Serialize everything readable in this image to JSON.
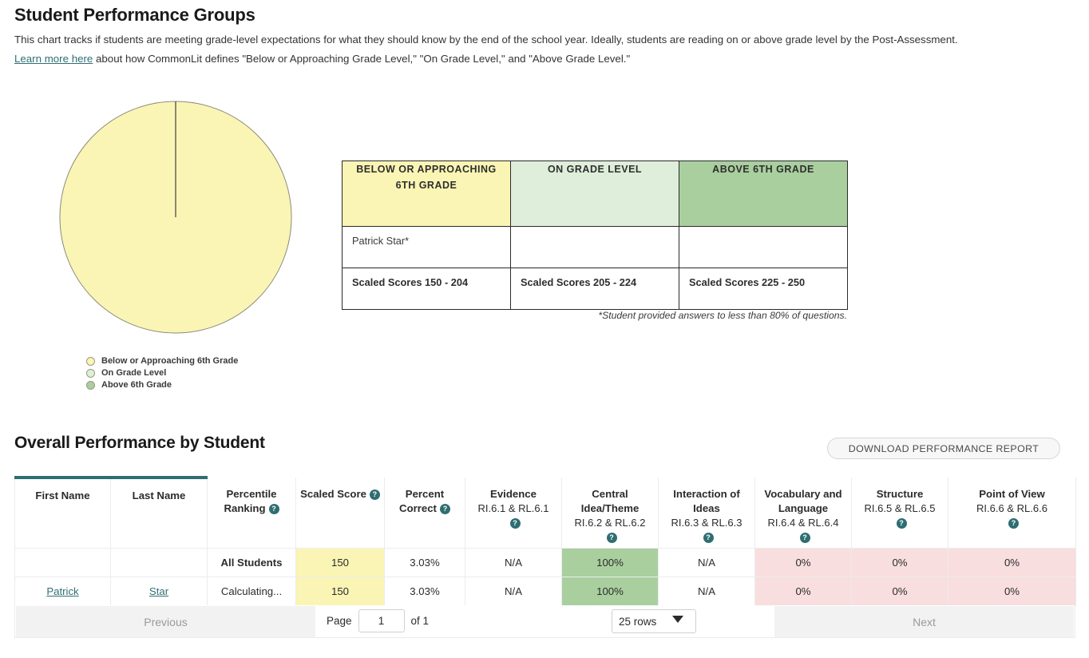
{
  "groups": {
    "title": "Student Performance Groups",
    "intro_line1": "This chart tracks if students are meeting grade-level expectations for what they should know by the end of the school year. Ideally, students are reading on or above grade level by the Post-Assessment.",
    "link_text": "Learn more here",
    "intro_line2": " about how CommonLit defines \"Below or Approaching Grade Level,\" \"On Grade Level,\" and \"Above Grade Level.\"",
    "footnote": "*Student provided answers to less than 80% of questions.",
    "legend": [
      {
        "label": "Below or Approaching 6th Grade",
        "color": "#faf5b4"
      },
      {
        "label": "On Grade Level",
        "color": "#dfeedb"
      },
      {
        "label": "Above 6th Grade",
        "color": "#a9cf9f"
      }
    ],
    "band_headers": [
      "BELOW OR APPROACHING 6TH GRADE",
      "ON GRADE LEVEL",
      "ABOVE 6TH GRADE"
    ],
    "band_students": [
      "Patrick Star*",
      "",
      ""
    ],
    "band_scores": [
      "Scaled Scores 150 - 204",
      "Scaled Scores 205 - 224",
      "Scaled Scores 225 - 250"
    ]
  },
  "chart_data": {
    "type": "pie",
    "title": "Student Performance Groups",
    "categories": [
      "Below or Approaching 6th Grade",
      "On Grade Level",
      "Above 6th Grade"
    ],
    "values": [
      100,
      0,
      0
    ],
    "colors": [
      "#faf5b4",
      "#dfeedb",
      "#a9cf9f"
    ],
    "legend_position": "bottom-left",
    "unit": "percent of students"
  },
  "performance": {
    "title": "Overall Performance by Student",
    "download_label": "DOWNLOAD PERFORMANCE REPORT",
    "columns": [
      {
        "main": "First Name",
        "sub": "",
        "help": false
      },
      {
        "main": "Last Name",
        "sub": "",
        "help": false
      },
      {
        "main": "Percentile Ranking",
        "sub": "",
        "help": true
      },
      {
        "main": "Scaled Score",
        "sub": "",
        "help": true
      },
      {
        "main": "Percent Correct",
        "sub": "",
        "help": true
      },
      {
        "main": "Evidence",
        "sub": "RI.6.1 & RL.6.1",
        "help": true
      },
      {
        "main": "Central Idea/Theme",
        "sub": "RI.6.2 & RL.6.2",
        "help": true
      },
      {
        "main": "Interaction of Ideas",
        "sub": "RI.6.3 & RL.6.3",
        "help": true
      },
      {
        "main": "Vocabulary and Language",
        "sub": "RI.6.4 & RL.6.4",
        "help": true
      },
      {
        "main": "Structure",
        "sub": "RI.6.5 & RL.6.5",
        "help": true
      },
      {
        "main": "Point of View",
        "sub": "RI.6.6 & RL.6.6",
        "help": true
      }
    ],
    "rows": [
      {
        "first_name": "",
        "last_name": "",
        "percentile": "All Students",
        "scaled_score": "150",
        "percent_correct": "3.03%",
        "evidence": "N/A",
        "central_idea": "100%",
        "interaction": "N/A",
        "vocabulary": "0%",
        "structure": "0%",
        "point_of_view": "0%"
      },
      {
        "first_name": "Patrick",
        "last_name": "Star",
        "percentile": "Calculating...",
        "scaled_score": "150",
        "percent_correct": "3.03%",
        "evidence": "N/A",
        "central_idea": "100%",
        "interaction": "N/A",
        "vocabulary": "0%",
        "structure": "0%",
        "point_of_view": "0%"
      }
    ],
    "pager": {
      "previous": "Previous",
      "next": "Next",
      "page_label": "Page",
      "page_value": "1",
      "of_label": "of 1",
      "rows_selected": "25 rows"
    }
  },
  "theme": {
    "accent_teal": "#2e6e73",
    "yellow": "#faf5b4",
    "green": "#a9cf9f",
    "light_green": "#dfeedb",
    "pink": "#f8dede"
  }
}
